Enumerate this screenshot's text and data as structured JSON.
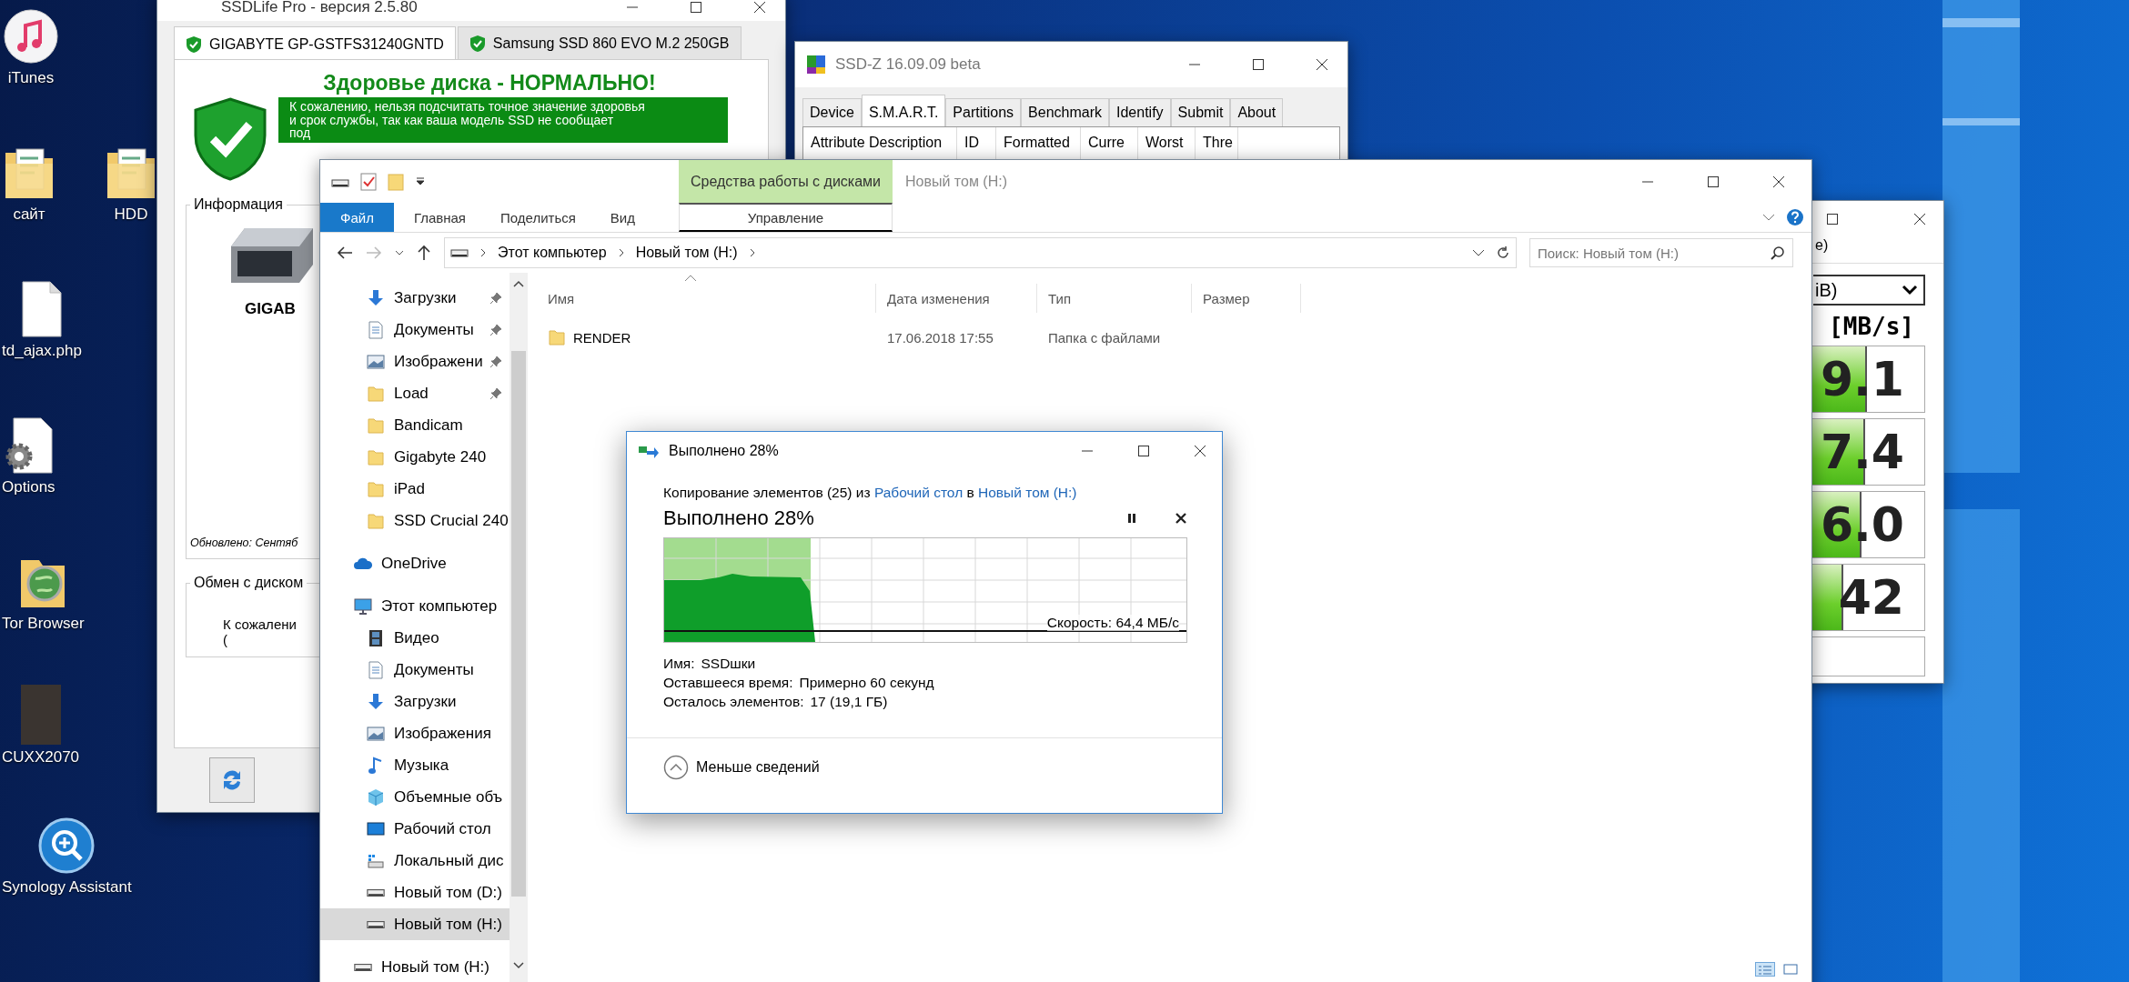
{
  "desktop_icons": [
    {
      "label": "iTunes",
      "kind": "itunes"
    },
    {
      "label": "сайт",
      "kind": "folder_doc"
    },
    {
      "label": "HDD",
      "kind": "folder_doc"
    },
    {
      "label": "td_ajax.php",
      "kind": "file"
    },
    {
      "label": "Options",
      "kind": "gear_file"
    },
    {
      "label": "Tor Browser",
      "kind": "folder_globe"
    },
    {
      "label": "CUXX2070",
      "kind": "photo"
    },
    {
      "label": "Synology Assistant",
      "kind": "search_app"
    }
  ],
  "ssdlife": {
    "title": "SSDLife Pro - версия 2.5.80",
    "tabs": [
      {
        "label": "GIGABYTE GP-GSTFS31240GNTD",
        "selected": true
      },
      {
        "label": "Samsung SSD 860 EVO M.2 250GB",
        "selected": false
      }
    ],
    "health_heading": "Здоровье диска - НОРМАЛЬНО!",
    "banner_lines": [
      "К сожалению, нельзя подсчитать точное значение здоровья",
      "и срок службы, так как ваша модель SSD не сообщает",
      "под"
    ],
    "info_group": {
      "legend": "Информация",
      "model": "GIGAB",
      "updated": "Обновлено: Сентяб"
    },
    "exchange_group": {
      "legend": "Обмен с диском",
      "lines": [
        "К сожалени",
        "("
      ]
    }
  },
  "ssdz": {
    "title": "SSD-Z 16.09.09 beta",
    "tabs": [
      {
        "label": "Device",
        "selected": false
      },
      {
        "label": "S.M.A.R.T.",
        "selected": true
      },
      {
        "label": "Partitions",
        "selected": false
      },
      {
        "label": "Benchmark",
        "selected": false
      },
      {
        "label": "Identify",
        "selected": false
      },
      {
        "label": "Submit",
        "selected": false
      },
      {
        "label": "About",
        "selected": false
      }
    ],
    "columns": [
      "Attribute Description",
      "ID",
      "Formatted",
      "Curre",
      "Worst",
      "Thre"
    ]
  },
  "benchmark": {
    "menu_fragment": "e)",
    "dropdown": "iB)",
    "unit_label": "[MB/s]",
    "results": [
      {
        "value": "9.1",
        "level": 0.71
      },
      {
        "value": "7.4",
        "level": 0.7
      },
      {
        "value": "6.0",
        "level": 0.68
      },
      {
        "value": "42",
        "level": 0.59
      }
    ]
  },
  "explorer": {
    "title": "Новый том (H:)",
    "contextual": {
      "header": "Средства работы с дисками",
      "tab": "Управление"
    },
    "ribbon_tabs": [
      {
        "label": "Файл",
        "selected": true
      },
      {
        "label": "Главная",
        "selected": false
      },
      {
        "label": "Поделиться",
        "selected": false
      },
      {
        "label": "Вид",
        "selected": false
      }
    ],
    "breadcrumb": [
      "Этот компьютер",
      "Новый том (H:)"
    ],
    "search": {
      "placeholder": "Поиск: Новый том (H:)"
    },
    "quick_access": [
      {
        "label": "Загрузки",
        "kind": "download",
        "pinned": true,
        "selected": false
      },
      {
        "label": "Документы",
        "kind": "document",
        "pinned": true,
        "selected": false
      },
      {
        "label": "Изображени",
        "kind": "pictures",
        "pinned": true,
        "selected": false
      },
      {
        "label": "Load",
        "kind": "folder",
        "pinned": true,
        "selected": false
      },
      {
        "label": "Bandicam",
        "kind": "folder",
        "pinned": false,
        "selected": false
      },
      {
        "label": "Gigabyte 240",
        "kind": "folder",
        "pinned": false,
        "selected": false
      },
      {
        "label": "iPad",
        "kind": "folder",
        "pinned": false,
        "selected": false
      },
      {
        "label": "SSD Crucial 240",
        "kind": "folder",
        "pinned": false,
        "selected": false
      }
    ],
    "tree": [
      {
        "label": "OneDrive",
        "kind": "onedrive",
        "selected": false
      },
      {
        "label": "Этот компьютер",
        "kind": "computer",
        "selected": false,
        "children": [
          {
            "label": "Видео",
            "kind": "video",
            "selected": false
          },
          {
            "label": "Документы",
            "kind": "document",
            "selected": false
          },
          {
            "label": "Загрузки",
            "kind": "download",
            "selected": false
          },
          {
            "label": "Изображения",
            "kind": "pictures",
            "selected": false
          },
          {
            "label": "Музыка",
            "kind": "music",
            "selected": false
          },
          {
            "label": "Объемные объ",
            "kind": "objects3d",
            "selected": false
          },
          {
            "label": "Рабочий стол",
            "kind": "desktop",
            "selected": false
          },
          {
            "label": "Локальный дис",
            "kind": "localdisk",
            "selected": false
          },
          {
            "label": "Новый том (D:)",
            "kind": "drive",
            "selected": false
          },
          {
            "label": "Новый том (H:)",
            "kind": "drive",
            "selected": true
          }
        ]
      },
      {
        "label": "Новый том (H:)",
        "kind": "drive",
        "selected": false
      }
    ],
    "columns": [
      "Имя",
      "Дата изменения",
      "Тип",
      "Размер"
    ],
    "rows": [
      {
        "name": "RENDER",
        "modified": "17.06.2018 17:55",
        "type": "Папка с файлами"
      }
    ],
    "view_buttons": [
      {
        "kind": "details",
        "selected": true
      },
      {
        "kind": "tiles",
        "selected": false
      }
    ]
  },
  "copy_dialog": {
    "title": "Выполнено 28%",
    "description": {
      "prefix": "Копирование элементов (25) из",
      "source": "Рабочий стол",
      "joiner": "в",
      "destination": "Новый том (H:)"
    },
    "heading": "Выполнено 28%",
    "level": 0.28,
    "speed": "Скорость: 64,4 МБ/с",
    "details": [
      {
        "label": "Имя:",
        "value": "SSDшки"
      },
      {
        "label": "Оставшееся время:",
        "value": "Примерно 60 секунд"
      },
      {
        "label": "Осталось элементов:",
        "value": "17 (19,1 ГБ)"
      }
    ],
    "toggle": "Меньше сведений"
  }
}
